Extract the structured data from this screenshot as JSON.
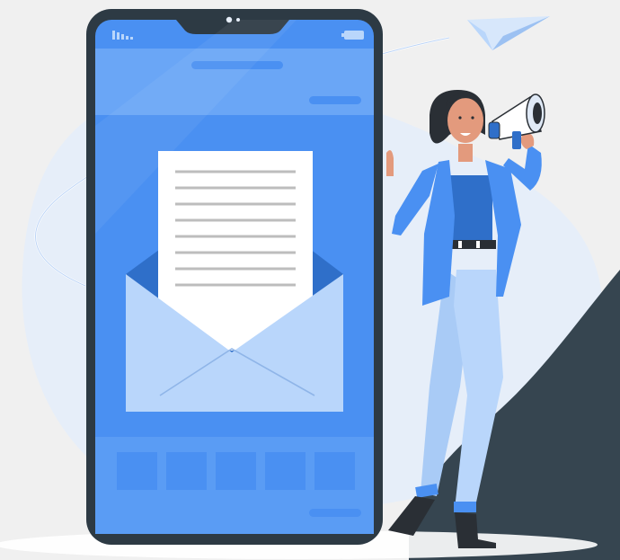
{
  "illustration": {
    "subject": "email-marketing",
    "icons": [
      "paper-plane-icon",
      "envelope-icon",
      "megaphone-icon",
      "signal-icon",
      "battery-icon"
    ]
  },
  "colors": {
    "background": "#f0f0f0",
    "blob": "#e6eef9",
    "dark_corner": "#364550",
    "phone_frame": "#2d3a44",
    "screen": "#4a90f2",
    "screen_light": "#6aa6f6",
    "envelope": "#b9d6fb",
    "letter": "#ffffff",
    "letter_lines": "#bdbdbd",
    "jacket": "#4a90f2",
    "pants": "#b9d6fb",
    "skin": "#e39a7d",
    "hair": "#2a2f35"
  },
  "phone": {
    "bottom_tiles": 5,
    "letter_lines": 8
  }
}
